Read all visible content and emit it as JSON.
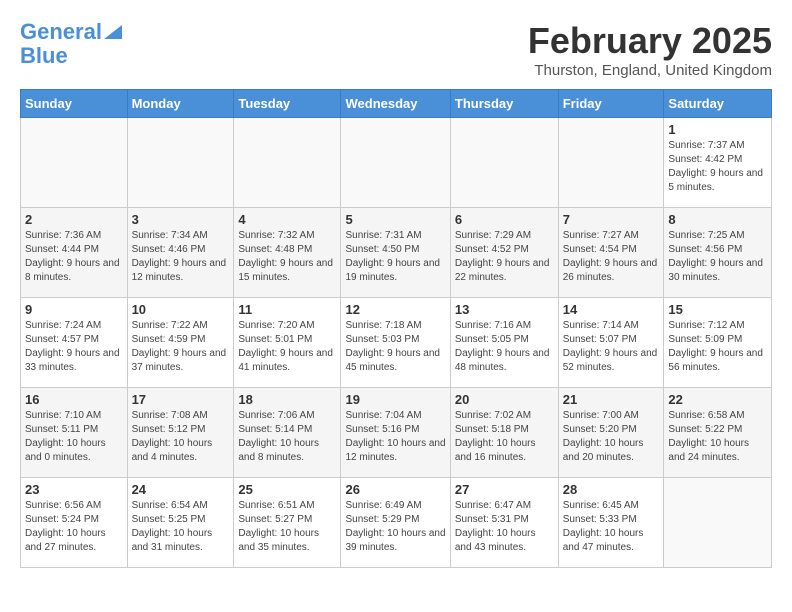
{
  "header": {
    "logo_line1": "General",
    "logo_line2": "Blue",
    "month_title": "February 2025",
    "location": "Thurston, England, United Kingdom"
  },
  "days_of_week": [
    "Sunday",
    "Monday",
    "Tuesday",
    "Wednesday",
    "Thursday",
    "Friday",
    "Saturday"
  ],
  "weeks": [
    [
      {
        "day": "",
        "info": ""
      },
      {
        "day": "",
        "info": ""
      },
      {
        "day": "",
        "info": ""
      },
      {
        "day": "",
        "info": ""
      },
      {
        "day": "",
        "info": ""
      },
      {
        "day": "",
        "info": ""
      },
      {
        "day": "1",
        "info": "Sunrise: 7:37 AM\nSunset: 4:42 PM\nDaylight: 9 hours and 5 minutes."
      }
    ],
    [
      {
        "day": "2",
        "info": "Sunrise: 7:36 AM\nSunset: 4:44 PM\nDaylight: 9 hours and 8 minutes."
      },
      {
        "day": "3",
        "info": "Sunrise: 7:34 AM\nSunset: 4:46 PM\nDaylight: 9 hours and 12 minutes."
      },
      {
        "day": "4",
        "info": "Sunrise: 7:32 AM\nSunset: 4:48 PM\nDaylight: 9 hours and 15 minutes."
      },
      {
        "day": "5",
        "info": "Sunrise: 7:31 AM\nSunset: 4:50 PM\nDaylight: 9 hours and 19 minutes."
      },
      {
        "day": "6",
        "info": "Sunrise: 7:29 AM\nSunset: 4:52 PM\nDaylight: 9 hours and 22 minutes."
      },
      {
        "day": "7",
        "info": "Sunrise: 7:27 AM\nSunset: 4:54 PM\nDaylight: 9 hours and 26 minutes."
      },
      {
        "day": "8",
        "info": "Sunrise: 7:25 AM\nSunset: 4:56 PM\nDaylight: 9 hours and 30 minutes."
      }
    ],
    [
      {
        "day": "9",
        "info": "Sunrise: 7:24 AM\nSunset: 4:57 PM\nDaylight: 9 hours and 33 minutes."
      },
      {
        "day": "10",
        "info": "Sunrise: 7:22 AM\nSunset: 4:59 PM\nDaylight: 9 hours and 37 minutes."
      },
      {
        "day": "11",
        "info": "Sunrise: 7:20 AM\nSunset: 5:01 PM\nDaylight: 9 hours and 41 minutes."
      },
      {
        "day": "12",
        "info": "Sunrise: 7:18 AM\nSunset: 5:03 PM\nDaylight: 9 hours and 45 minutes."
      },
      {
        "day": "13",
        "info": "Sunrise: 7:16 AM\nSunset: 5:05 PM\nDaylight: 9 hours and 48 minutes."
      },
      {
        "day": "14",
        "info": "Sunrise: 7:14 AM\nSunset: 5:07 PM\nDaylight: 9 hours and 52 minutes."
      },
      {
        "day": "15",
        "info": "Sunrise: 7:12 AM\nSunset: 5:09 PM\nDaylight: 9 hours and 56 minutes."
      }
    ],
    [
      {
        "day": "16",
        "info": "Sunrise: 7:10 AM\nSunset: 5:11 PM\nDaylight: 10 hours and 0 minutes."
      },
      {
        "day": "17",
        "info": "Sunrise: 7:08 AM\nSunset: 5:12 PM\nDaylight: 10 hours and 4 minutes."
      },
      {
        "day": "18",
        "info": "Sunrise: 7:06 AM\nSunset: 5:14 PM\nDaylight: 10 hours and 8 minutes."
      },
      {
        "day": "19",
        "info": "Sunrise: 7:04 AM\nSunset: 5:16 PM\nDaylight: 10 hours and 12 minutes."
      },
      {
        "day": "20",
        "info": "Sunrise: 7:02 AM\nSunset: 5:18 PM\nDaylight: 10 hours and 16 minutes."
      },
      {
        "day": "21",
        "info": "Sunrise: 7:00 AM\nSunset: 5:20 PM\nDaylight: 10 hours and 20 minutes."
      },
      {
        "day": "22",
        "info": "Sunrise: 6:58 AM\nSunset: 5:22 PM\nDaylight: 10 hours and 24 minutes."
      }
    ],
    [
      {
        "day": "23",
        "info": "Sunrise: 6:56 AM\nSunset: 5:24 PM\nDaylight: 10 hours and 27 minutes."
      },
      {
        "day": "24",
        "info": "Sunrise: 6:54 AM\nSunset: 5:25 PM\nDaylight: 10 hours and 31 minutes."
      },
      {
        "day": "25",
        "info": "Sunrise: 6:51 AM\nSunset: 5:27 PM\nDaylight: 10 hours and 35 minutes."
      },
      {
        "day": "26",
        "info": "Sunrise: 6:49 AM\nSunset: 5:29 PM\nDaylight: 10 hours and 39 minutes."
      },
      {
        "day": "27",
        "info": "Sunrise: 6:47 AM\nSunset: 5:31 PM\nDaylight: 10 hours and 43 minutes."
      },
      {
        "day": "28",
        "info": "Sunrise: 6:45 AM\nSunset: 5:33 PM\nDaylight: 10 hours and 47 minutes."
      },
      {
        "day": "",
        "info": ""
      }
    ]
  ]
}
